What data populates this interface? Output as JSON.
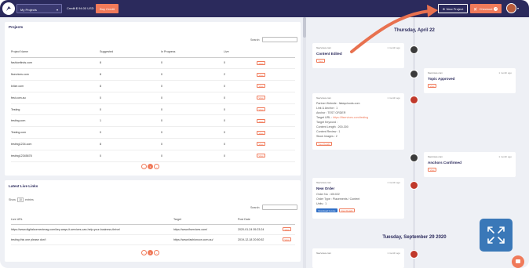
{
  "topbar": {
    "project_select": "My Projects",
    "credit": "Credit $ 94.00 USD",
    "buy_credit": "Buy Credit",
    "new_project": "New Project",
    "checkout": "Checkout",
    "checkout_count": "0"
  },
  "projects": {
    "title": "Projects",
    "search_label": "Search:",
    "columns": [
      "Project Name",
      "Suggested",
      "In Progress",
      "Live",
      ""
    ],
    "rows": [
      {
        "name": "fashionfinds.com",
        "suggested": "8",
        "progress": "0",
        "live": "0",
        "action": "View"
      },
      {
        "name": "fiservices.com",
        "suggested": "8",
        "progress": "0",
        "live": "2",
        "action": "View"
      },
      {
        "name": "kriize.com",
        "suggested": "8",
        "progress": "0",
        "live": "0",
        "action": "View"
      },
      {
        "name": "fest.com.au",
        "suggested": "0",
        "progress": "0",
        "live": "0",
        "action": "View"
      },
      {
        "name": "Testing",
        "suggested": "0",
        "progress": "0",
        "live": "0",
        "action": "View"
      },
      {
        "name": "testing.com",
        "suggested": "1",
        "progress": "0",
        "live": "0",
        "action": "View"
      },
      {
        "name": "Testing.com",
        "suggested": "0",
        "progress": "0",
        "live": "0",
        "action": "View"
      },
      {
        "name": "testing1234.com",
        "suggested": "8",
        "progress": "0",
        "live": "0",
        "action": "View"
      },
      {
        "name": "testing12345678",
        "suggested": "0",
        "progress": "0",
        "live": "0",
        "action": "View"
      }
    ],
    "pager": {
      "prev": "‹",
      "current": "1",
      "next": "›"
    }
  },
  "live_links": {
    "title": "Latest Live Links",
    "show_label": "Show",
    "show_value": "10",
    "entries_label": "entries",
    "search_label": "Search:",
    "columns": [
      "Live URL",
      "Target",
      "Post Date",
      ""
    ],
    "rows": [
      {
        "url": "https://www.digitalconnectmag.com/key-ways-it-services-can-help-your-business-thrive/",
        "target": "https://www.fiservices.com/",
        "date": "2020-01-24 05:23:24",
        "action": "View"
      },
      {
        "url": "testing this one please don't",
        "target": "https://www.fashioncon.com.au/",
        "date": "2019-12-18 20:50:52",
        "action": "View"
      }
    ],
    "pager": {
      "prev": "‹",
      "current": "1",
      "next": "›"
    }
  },
  "timeline": {
    "date1": "Thursday, April 22",
    "date2": "Tuesday, September 29 2020",
    "cards": [
      {
        "site": "fiservices.com",
        "ago": "1 month ago",
        "title": "Content Edited",
        "button": "View"
      },
      {
        "site": "fiservices.com",
        "ago": "1 month ago",
        "title": "Topic Approved",
        "button": "View"
      },
      {
        "site": "fiservices.com",
        "ago": "1 month ago",
        "lines": [
          "Partner Website : fiataycloods.com",
          "Link & Anchor : 1",
          "Anchor : TEST ORDER",
          "Target URL : ",
          "Target Keyword : ",
          "Content Length : 200-300",
          "Content Review : 1",
          "Stock Images : 2"
        ],
        "target_url": "https://fiservices.com/testing",
        "button": "View Details"
      },
      {
        "site": "fiservices.com",
        "ago": "1 month ago",
        "title": "Anchors Confirmed",
        "button": "View"
      },
      {
        "site": "fiservices.com",
        "ago": "1 month ago",
        "title": "New Order",
        "lines": [
          "Order No : 401022",
          "Order Type : Placements / Content",
          "Units : 1"
        ],
        "button_primary": "Download Invoice",
        "button": "View Details"
      },
      {
        "site": "fiservices.com",
        "ago": "1 month ago"
      }
    ]
  },
  "colors": {
    "navy": "#2b2a5c",
    "accent": "#f07a5a",
    "blue": "#3a78b8"
  }
}
